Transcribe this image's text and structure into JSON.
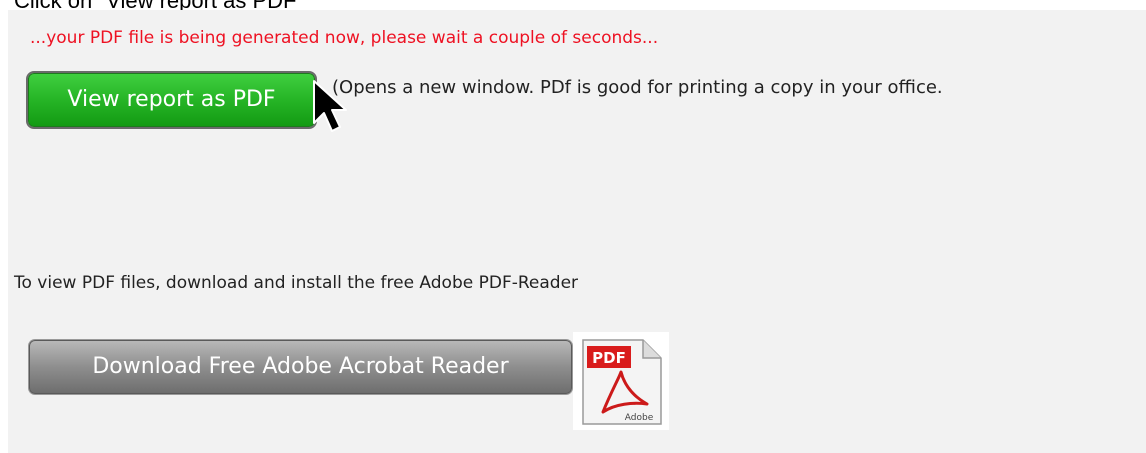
{
  "caption": {
    "text": "Click on \"View report as PDF\""
  },
  "status": {
    "message": "...your PDF file is being generated now, please wait a couple of seconds...",
    "color": "#ee1122"
  },
  "view_button": {
    "label": "View report as PDF",
    "color": "#26b526"
  },
  "opens_note": {
    "text": "(Opens a new window. PDf is good for printing a copy in your office."
  },
  "instruction": {
    "text": "To view PDF files, download and install the free Adobe PDF-Reader"
  },
  "download_button": {
    "label": "Download Free Adobe Acrobat Reader",
    "color": "#8e8e8e"
  },
  "pdf_icon": {
    "badge_text": "PDF",
    "brand_text": "Adobe",
    "icon": "adobe-pdf-icon"
  },
  "cursor": {
    "icon": "mouse-pointer-icon"
  }
}
